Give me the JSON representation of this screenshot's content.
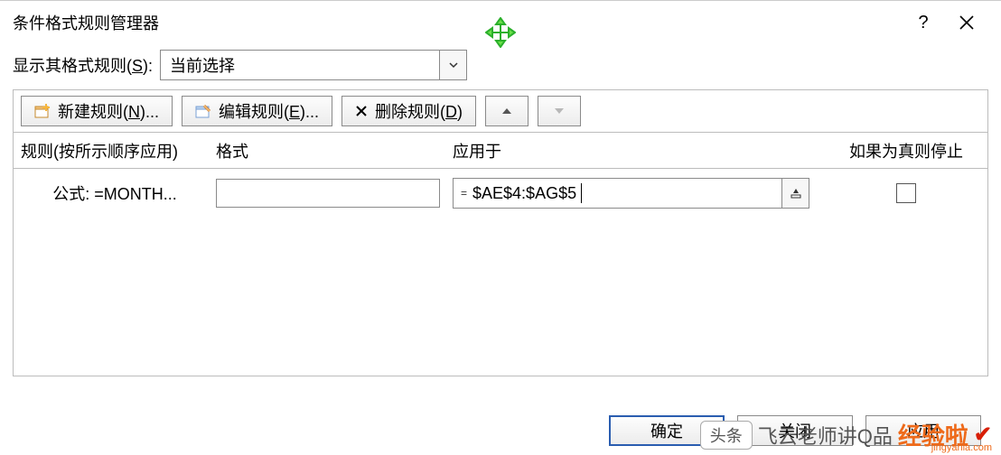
{
  "window": {
    "title": "条件格式规则管理器",
    "help": "?",
    "close": "×"
  },
  "showfor": {
    "label_pre": "显示其格式规则(",
    "label_u": "S",
    "label_post": "):",
    "selected": "当前选择"
  },
  "toolbar": {
    "new_pre": "新建规则(",
    "new_u": "N",
    "new_post": ")...",
    "edit_pre": "编辑规则(",
    "edit_u": "E",
    "edit_post": ")...",
    "del_pre": "删除规则(",
    "del_u": "D",
    "del_post": ")"
  },
  "headers": {
    "rule": "规则(按所示顺序应用)",
    "format": "格式",
    "apply": "应用于",
    "stop": "如果为真则停止"
  },
  "rows": [
    {
      "rule": "公式: =MONTH...",
      "apply_prefix": "=",
      "apply": "$AE$4:$AG$5",
      "stop": false
    }
  ],
  "footer": {
    "ok": "确定",
    "close": "关闭",
    "apply": "应用"
  },
  "icons": {
    "move": "move-icon",
    "new": "new-rule-icon",
    "edit": "edit-rule-icon",
    "delete": "delete-rule-icon",
    "up": "move-up-icon",
    "down": "move-down-icon",
    "chevron": "chevron-down-icon",
    "collapse": "collapse-range-icon"
  },
  "watermark": {
    "t1": "头条",
    "t2": "飞云老师讲Q品",
    "t3": "经验啦",
    "domain": "jingyanla.com"
  }
}
